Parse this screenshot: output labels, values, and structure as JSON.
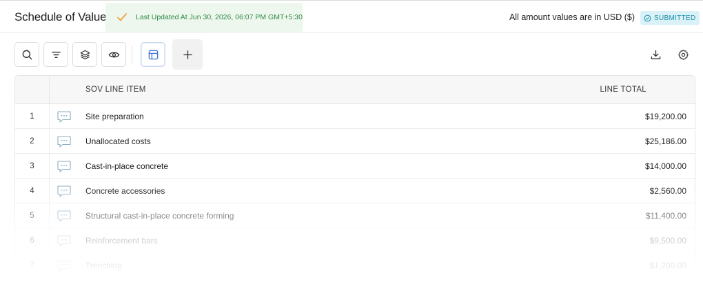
{
  "header": {
    "title": "Schedule of Values",
    "last_updated": "Last Updated At Jun 30, 2026, 06:07 PM GMT+5:30",
    "currency_note": "All amount values are in USD ($)",
    "status_badge": "SUBMITTED"
  },
  "toolbar": {
    "left_icons": [
      "search-icon",
      "filter-icon",
      "layers-icon",
      "eye-icon",
      "table-layout-icon",
      "plus-icon"
    ],
    "right_icons": [
      "download-icon",
      "gear-icon"
    ]
  },
  "table": {
    "columns": {
      "item": "SOV LINE ITEM",
      "total": "LINE TOTAL"
    },
    "rows": [
      {
        "num": "1",
        "item": "Site preparation",
        "total": "$19,200.00"
      },
      {
        "num": "2",
        "item": "Unallocated costs",
        "total": "$25,186.00"
      },
      {
        "num": "3",
        "item": "Cast-in-place concrete",
        "total": "$14,000.00"
      },
      {
        "num": "4",
        "item": "Concrete accessories",
        "total": "$2,560.00"
      },
      {
        "num": "5",
        "item": "Structural cast-in-place concrete forming",
        "total": "$11,400.00"
      },
      {
        "num": "6",
        "item": "Reinforcement bars",
        "total": "$9,500.00"
      },
      {
        "num": "7",
        "item": "Trenching",
        "total": "$1,200.00"
      }
    ]
  },
  "colors": {
    "updated_bg": "#eef7ee",
    "updated_text": "#2d8a45",
    "check": "#f0a23a",
    "badge_bg": "#d9f1f7",
    "badge_text": "#1c8fa9",
    "active_icon": "#3b73d9"
  }
}
